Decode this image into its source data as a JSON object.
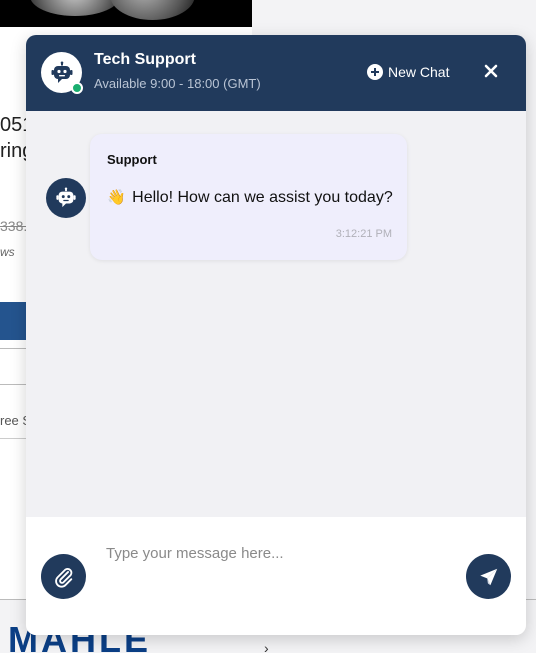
{
  "colors": {
    "accent": "#213a5c",
    "online": "#1aae6f",
    "bubble": "#efeefc"
  },
  "background_page": {
    "product_code_fragment": "051",
    "product_line2_fragment": "ring",
    "price_fragment": "338.",
    "reviews_fragment": "ws",
    "shipping_fragment": "ree S",
    "brand_logo": "MAHLE",
    "brand_reg": "®",
    "arrow_glyph": "›"
  },
  "chat": {
    "header": {
      "title": "Tech Support",
      "subtitle": "Available 9:00 - 18:00 (GMT)",
      "new_chat_label": "New Chat",
      "avatar_icon": "robot-icon",
      "new_chat_icon": "plus-circle-icon",
      "close_icon": "close-icon"
    },
    "messages": [
      {
        "sender": "Support",
        "emoji": "👋",
        "text": "Hello! How can we assist you today?",
        "time": "3:12:21 PM",
        "avatar_icon": "robot-icon"
      }
    ],
    "composer": {
      "placeholder": "Type your message here...",
      "value": "",
      "attach_icon": "paperclip-icon",
      "send_icon": "send-icon"
    }
  }
}
